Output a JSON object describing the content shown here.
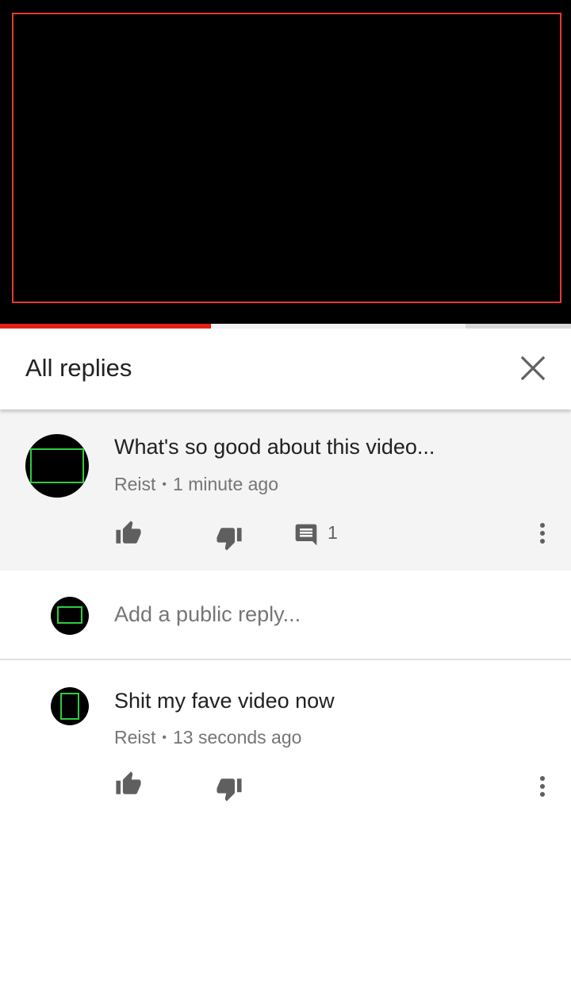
{
  "video": {
    "progress_played": 0.37,
    "progress_buffered": 0.815
  },
  "header": {
    "title": "All replies",
    "close_icon": "close-icon"
  },
  "parent_comment": {
    "text": "What's so good about this video...",
    "author": "Reist",
    "time": "1 minute ago",
    "reply_count": "1",
    "icons": [
      "like-icon",
      "dislike-icon",
      "comment-icon",
      "more-vert-icon"
    ]
  },
  "reply_box": {
    "placeholder": "Add a public reply..."
  },
  "replies": [
    {
      "text": "Shit my fave video now",
      "author": "Reist",
      "time": "13 seconds ago",
      "icons": [
        "like-icon",
        "dislike-icon",
        "more-vert-icon"
      ]
    }
  ],
  "colors": {
    "progress_red": "#e62117",
    "video_frame": "#e53935",
    "avatar_outline": "#2ecc40"
  }
}
